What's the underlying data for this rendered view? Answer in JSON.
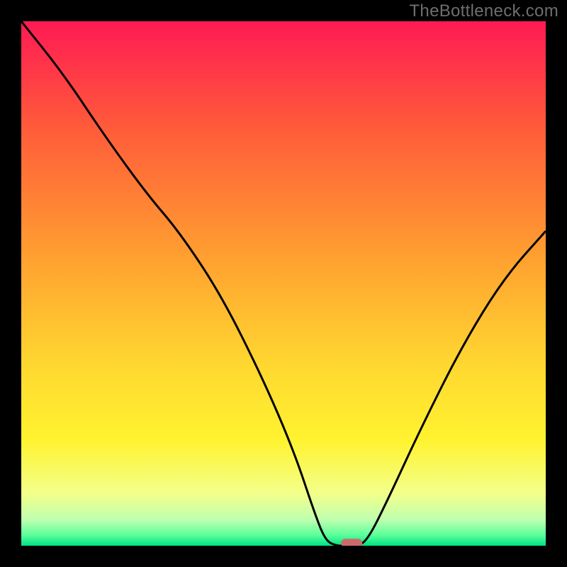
{
  "watermark": "TheBottleneck.com",
  "chart_data": {
    "type": "line",
    "title": "",
    "xlabel": "",
    "ylabel": "",
    "xlim": [
      0,
      100
    ],
    "ylim": [
      0,
      100
    ],
    "gradient_stops": [
      {
        "offset": 0,
        "color": "#ff1a54"
      },
      {
        "offset": 20,
        "color": "#ff5a3a"
      },
      {
        "offset": 45,
        "color": "#ffa030"
      },
      {
        "offset": 65,
        "color": "#ffd630"
      },
      {
        "offset": 80,
        "color": "#fff330"
      },
      {
        "offset": 90,
        "color": "#f3ff8a"
      },
      {
        "offset": 95,
        "color": "#c0ffb0"
      },
      {
        "offset": 98,
        "color": "#5aff9a"
      },
      {
        "offset": 100,
        "color": "#00e083"
      }
    ],
    "series": [
      {
        "name": "bottleneck-curve",
        "points": [
          {
            "x": 0,
            "y": 100
          },
          {
            "x": 8,
            "y": 90
          },
          {
            "x": 16,
            "y": 78
          },
          {
            "x": 24,
            "y": 67
          },
          {
            "x": 30,
            "y": 60
          },
          {
            "x": 38,
            "y": 48
          },
          {
            "x": 46,
            "y": 32
          },
          {
            "x": 52,
            "y": 18
          },
          {
            "x": 56,
            "y": 6
          },
          {
            "x": 58,
            "y": 1
          },
          {
            "x": 60,
            "y": 0
          },
          {
            "x": 62,
            "y": 0
          },
          {
            "x": 64,
            "y": 0
          },
          {
            "x": 66,
            "y": 1
          },
          {
            "x": 70,
            "y": 9
          },
          {
            "x": 76,
            "y": 22
          },
          {
            "x": 84,
            "y": 38
          },
          {
            "x": 92,
            "y": 51
          },
          {
            "x": 100,
            "y": 60
          }
        ]
      }
    ],
    "marker": {
      "x": 63,
      "y": 0.5,
      "color": "#cc6a6a"
    }
  }
}
